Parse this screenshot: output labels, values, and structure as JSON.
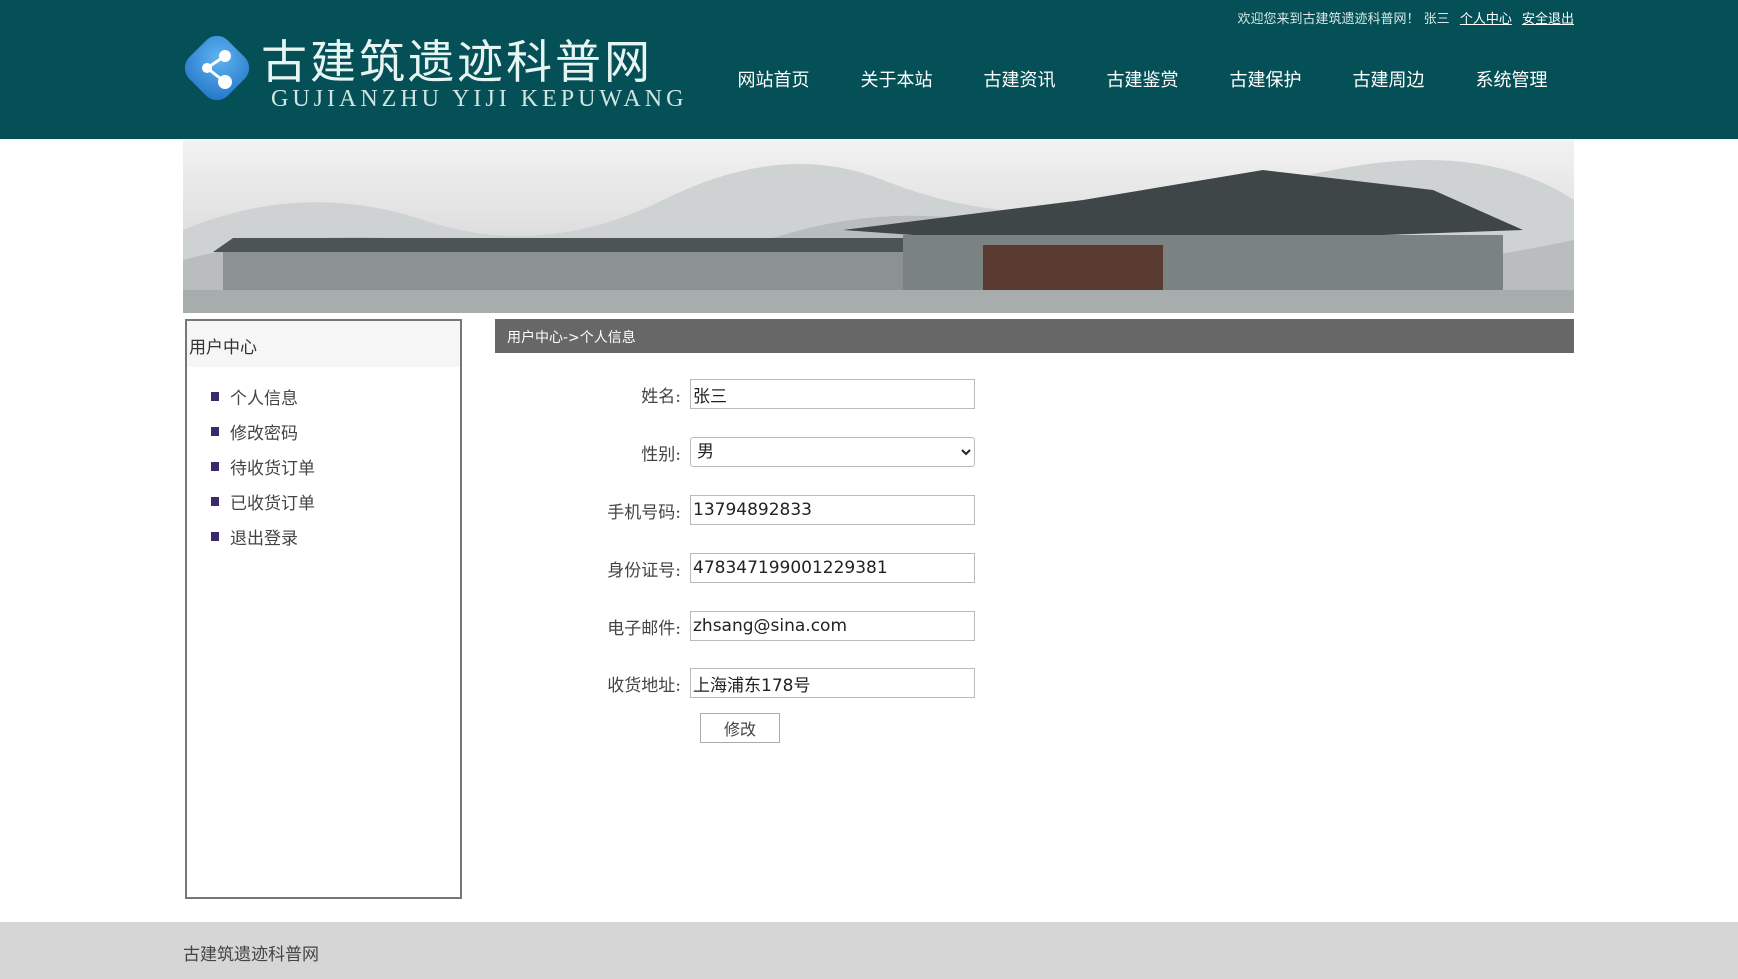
{
  "header": {
    "logo_title": "古建筑遗迹科普网",
    "logo_subtitle": "GUJIANZHU YIJI KEPUWANG",
    "welcome": "欢迎您来到古建筑遗迹科普网！ 张三",
    "user_center_link": "个人中心",
    "logout_link": "安全退出",
    "bg_color": "#045056"
  },
  "nav": [
    "网站首页",
    "关于本站",
    "古建资讯",
    "古建鉴赏",
    "古建保护",
    "古建周边",
    "系统管理"
  ],
  "sidebar": {
    "title": "用户中心",
    "items": [
      "个人信息",
      "修改密码",
      "待收货订单",
      "已收货订单",
      "退出登录"
    ]
  },
  "breadcrumb": "用户中心->个人信息",
  "form": {
    "name_label": "姓名:",
    "name_value": "张三",
    "gender_label": "性别:",
    "gender_value": "男",
    "phone_label": "手机号码:",
    "phone_value": "13794892833",
    "id_label": "身份证号:",
    "id_value": "478347199001229381",
    "email_label": "电子邮件:",
    "email_value": "zhsang@sina.com",
    "address_label": "收货地址:",
    "address_value": "上海浦东178号",
    "submit_label": "修改"
  },
  "footer": "古建筑遗迹科普网"
}
